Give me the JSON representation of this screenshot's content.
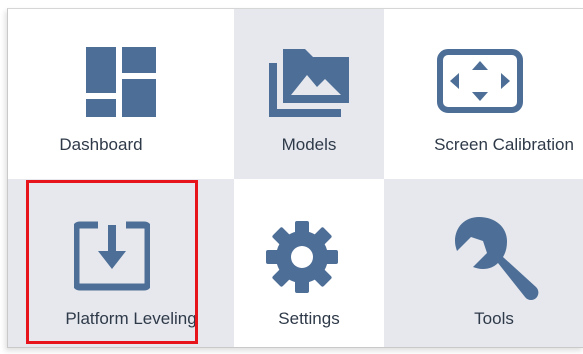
{
  "colors": {
    "icon": "#4d6e96",
    "tile_shaded": "#e6e8ee",
    "tile_plain": "#ffffff",
    "label": "#2f3a49",
    "highlight": "#e8141c"
  },
  "tiles": [
    {
      "label": "Dashboard",
      "icon": "dashboard-grid-icon"
    },
    {
      "label": "Models",
      "icon": "image-folder-icon"
    },
    {
      "label": "Screen Calibration",
      "icon": "screen-arrows-icon"
    },
    {
      "label": "Platform Leveling",
      "icon": "download-tray-icon",
      "highlighted": true
    },
    {
      "label": "Settings",
      "icon": "gear-icon"
    },
    {
      "label": "Tools",
      "icon": "wrench-icon"
    }
  ]
}
